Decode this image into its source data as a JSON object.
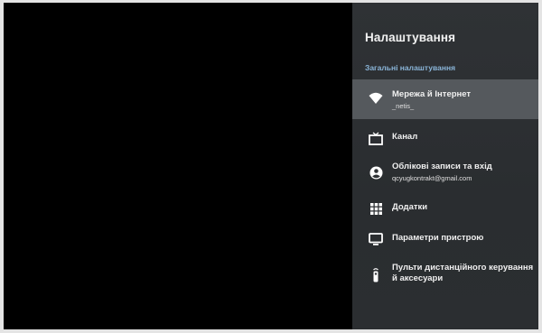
{
  "settings": {
    "title": "Налаштування",
    "section_label": "Загальні налаштування",
    "items": [
      {
        "label": "Мережа й Інтернет",
        "subtitle": "_netis_",
        "icon": "wifi-icon",
        "selected": true
      },
      {
        "label": "Канал",
        "icon": "tv-icon"
      },
      {
        "label": "Облікові записи та вхід",
        "subtitle": "qcyugkontrakt@gmail.com",
        "icon": "account-icon"
      },
      {
        "label": "Додатки",
        "icon": "apps-grid-icon"
      },
      {
        "label": "Параметри пристрою",
        "icon": "monitor-icon"
      },
      {
        "label": "Пульти дистанційного керування й аксесуари",
        "icon": "remote-icon"
      }
    ]
  },
  "colors": {
    "panel_bg": "#2f3235",
    "selected_bg": "#55595d",
    "section_label": "#8ab4d8"
  }
}
